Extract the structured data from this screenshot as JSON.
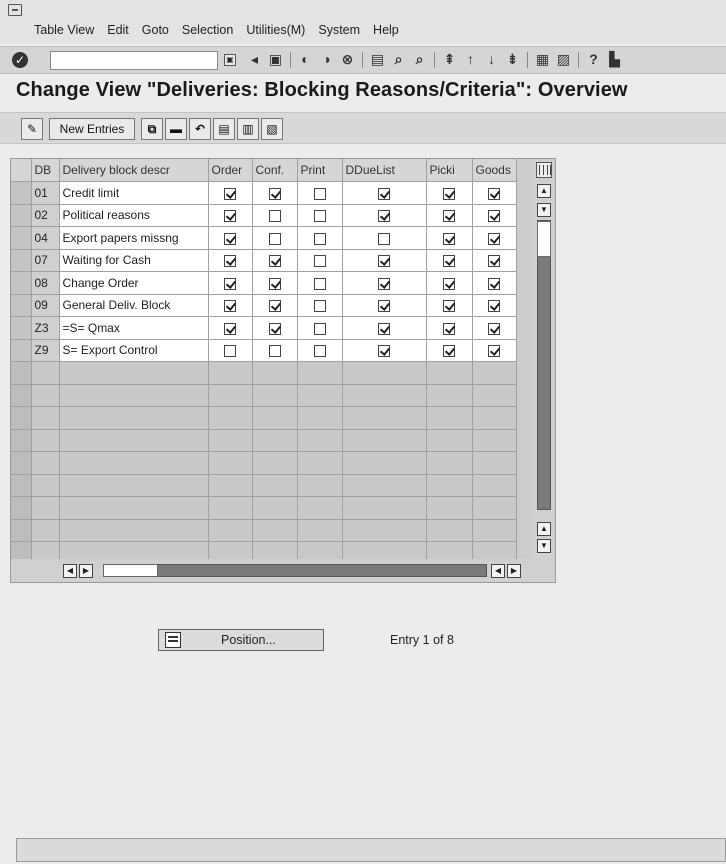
{
  "menu": {
    "items": [
      "Table View",
      "Edit",
      "Goto",
      "Selection",
      "Utilities(M)",
      "System",
      "Help"
    ]
  },
  "system_toolbar": {
    "command_field_value": "",
    "icons": [
      "enter-icon",
      "command-dropdown-icon",
      "back-arrow-icon",
      "save-icon",
      "back-icon",
      "exit-icon",
      "cancel-icon",
      "print-icon",
      "find-icon",
      "find-next-icon",
      "first-page-icon",
      "previous-page-icon",
      "next-page-icon",
      "last-page-icon",
      "create-session-icon",
      "shortcut-icon",
      "help-icon",
      "layout-menu-icon"
    ]
  },
  "page": {
    "title": "Change View \"Deliveries: Blocking Reasons/Criteria\": Overview"
  },
  "app_toolbar": {
    "new_entries_label": "New Entries"
  },
  "table": {
    "columns": [
      "DB",
      "Delivery block descr",
      "Order",
      "Conf.",
      "Print",
      "DDueList",
      "Picki",
      "Goods"
    ],
    "rows": [
      {
        "db": "01",
        "descr": "Credit limit",
        "order": true,
        "conf": true,
        "print": false,
        "dduelist": true,
        "picki": true,
        "goods": true
      },
      {
        "db": "02",
        "descr": "Political reasons",
        "order": true,
        "conf": false,
        "print": false,
        "dduelist": true,
        "picki": true,
        "goods": true
      },
      {
        "db": "04",
        "descr": "Export papers missng",
        "order": true,
        "conf": false,
        "print": false,
        "dduelist": false,
        "picki": true,
        "goods": true
      },
      {
        "db": "07",
        "descr": "Waiting for Cash",
        "order": true,
        "conf": true,
        "print": false,
        "dduelist": true,
        "picki": true,
        "goods": true
      },
      {
        "db": "08",
        "descr": "Change Order",
        "order": true,
        "conf": true,
        "print": false,
        "dduelist": true,
        "picki": true,
        "goods": true
      },
      {
        "db": "09",
        "descr": "General Deliv. Block",
        "order": true,
        "conf": true,
        "print": false,
        "dduelist": true,
        "picki": true,
        "goods": true
      },
      {
        "db": "Z3",
        "descr": "=S= Qmax",
        "order": true,
        "conf": true,
        "print": false,
        "dduelist": true,
        "picki": true,
        "goods": true
      },
      {
        "db": "Z9",
        "descr": "S= Export Control",
        "order": false,
        "conf": false,
        "print": false,
        "dduelist": true,
        "picki": true,
        "goods": true
      }
    ],
    "empty_rows": 9
  },
  "position": {
    "button_label": "Position...",
    "entry_info": "Entry 1 of 8"
  }
}
